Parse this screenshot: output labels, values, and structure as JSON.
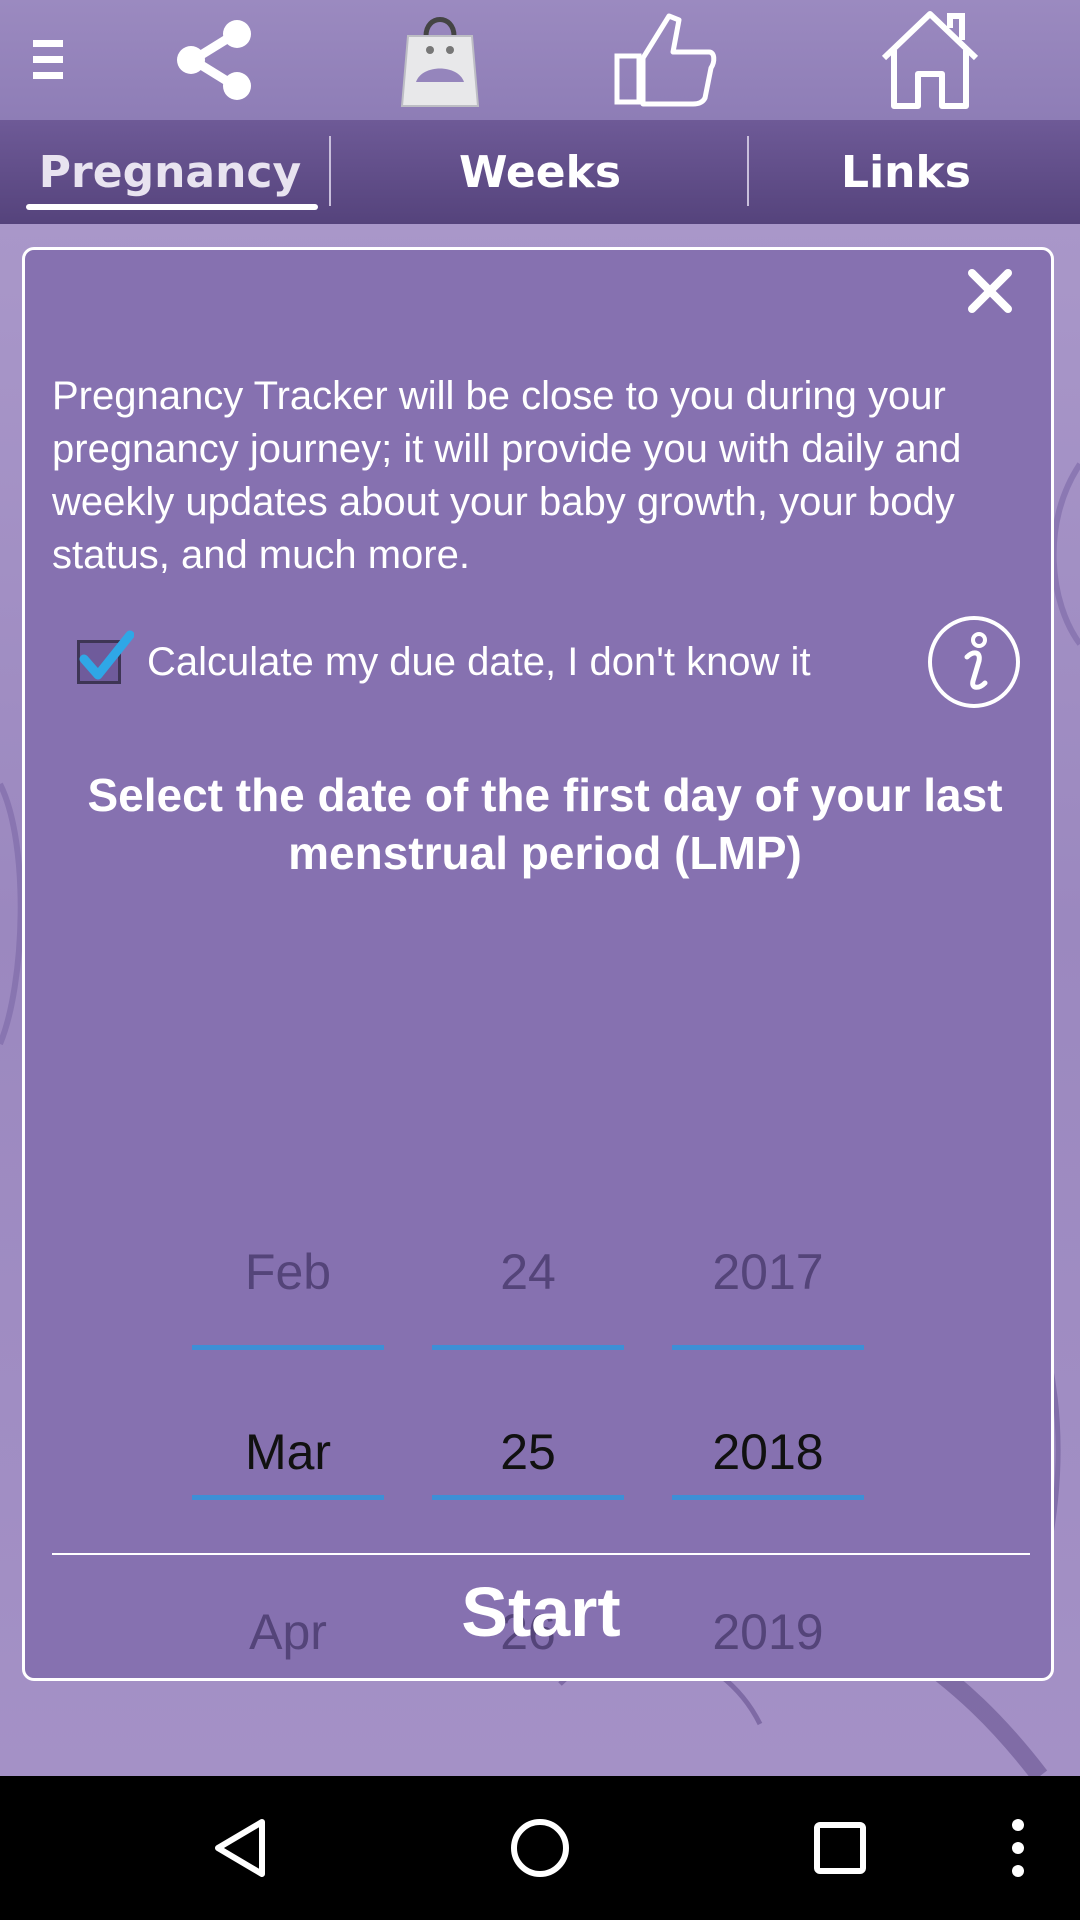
{
  "toolbar": {
    "icons": [
      "menu-icon",
      "share-icon",
      "shopping-bag-icon",
      "thumbs-up-icon",
      "home-icon"
    ]
  },
  "tabs": {
    "items": [
      {
        "label": "Pregnancy",
        "active": true
      },
      {
        "label": "Weeks",
        "active": false
      },
      {
        "label": "Links",
        "active": false
      }
    ]
  },
  "dialog": {
    "intro": "Pregnancy Tracker will be close to you during your pregnancy journey; it will provide you with daily and weekly updates about your baby growth, your body status, and much more.",
    "checkbox": {
      "label": "Calculate my due date, I don't know it",
      "checked": true
    },
    "lmp_title": "Select the date of the first day of your last menstrual period (LMP)",
    "picker": {
      "month": {
        "prev": "Feb",
        "current": "Mar",
        "next": "Apr"
      },
      "day": {
        "prev": "24",
        "current": "25",
        "next": "26"
      },
      "year": {
        "prev": "2017",
        "current": "2018",
        "next": "2019"
      }
    },
    "start_label": "Start"
  },
  "colors": {
    "accent": "#3d8fd6",
    "dialog_bg": "#8671b0",
    "tab_bg": "#55437c"
  }
}
